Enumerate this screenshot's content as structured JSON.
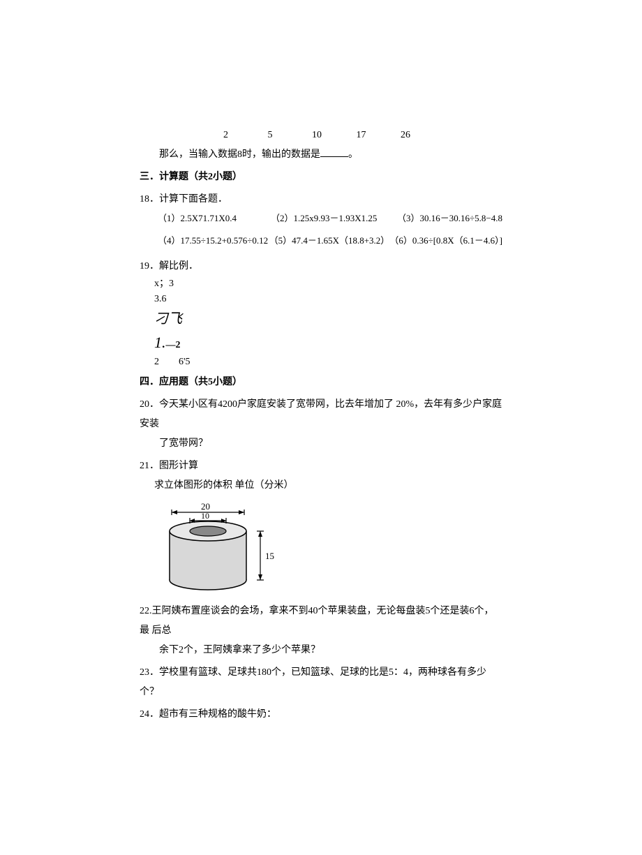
{
  "table": {
    "outputs": [
      "2",
      "5",
      "10",
      "17",
      "26"
    ]
  },
  "q17_text": "那么，当输入数据8时，输出的数据是",
  "q17_suffix": "。",
  "section3": "三．计算题（共2小题）",
  "q18": {
    "stem": "18．计算下面各题．",
    "r1c1": "（1）2.5X71.71X0.4",
    "r1c2": "（2）1.25x9.93－1.93X1.25",
    "r1c3": "（3）30.16－30.16÷5.8−4.8",
    "r2c1": "（4）17.55÷15.2+0.576÷0.12",
    "r2c2": "（5）47.4－1.65X（18.8+3.2）",
    "r2c3": "（6）0.36÷[0.8X（6.1－4.6）]"
  },
  "q19": {
    "stem": "19．解比例．",
    "l1": "x；3",
    "l2": "3.6",
    "l3": "刁飞",
    "l4a": "1.",
    "l4b": "—2",
    "l5": "2　　6'5"
  },
  "section4": "四．应用题（共5小题）",
  "q20": {
    "line1": "20．今天某小区有4200户家庭安装了宽带网，比去年增加了 20%，去年有多少户家庭安装",
    "line2": "了宽带网？"
  },
  "q21": {
    "stem": "21．图形计算",
    "sub": "求立体图形的体积 单位（分米）",
    "d_outer": "20",
    "d_inner": "10",
    "height": "15"
  },
  "q22": {
    "line1": "22.王阿姨布置座谈会的会场，拿来不到40个苹果装盘，无论每盘装5个还是装6个，最 后总",
    "line2": "余下2个，王阿姨拿来了多少个苹果？"
  },
  "q23": "23．学校里有篮球、足球共180个，已知篮球、足球的比是5：4，两种球各有多少个？",
  "q24": "24．超市有三种规格的酸牛奶："
}
